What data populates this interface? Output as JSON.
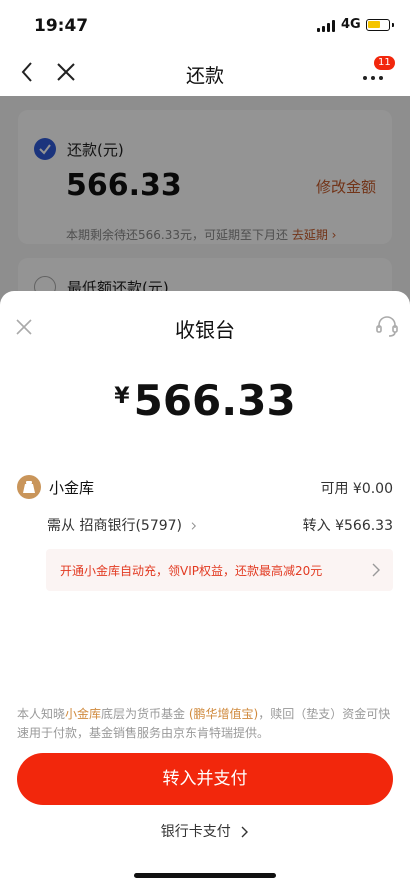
{
  "status_bar": {
    "time": "19:47",
    "network": "4G"
  },
  "nav": {
    "title": "还款",
    "badge_count": "11"
  },
  "background": {
    "repay_label": "还款(元)",
    "repay_amount": "566.33",
    "modify_label": "修改金额",
    "note_text": "本期剩余待还566.33元，可延期至下月还",
    "extend_label": "去延期 ›",
    "min_label": "最低额还款(元)"
  },
  "sheet": {
    "title": "收银台",
    "currency": "¥",
    "amount": "566.33",
    "vault": {
      "label": "小金库",
      "available": "可用 ¥0.00"
    },
    "source": {
      "prefix": "需从",
      "bank": "招商银行(5797)"
    },
    "transfer": "转入 ¥566.33",
    "promo": "开通小金库自动充，领VIP权益，还款最高减20元",
    "disclaimer": {
      "part1": "本人知晓",
      "hl1": "小金库",
      "part2": "底层为货币基金 ",
      "hl2": "(鹏华增值宝)",
      "part3": "，赎回（垫支）资金可快速用于付款，基金销售服务由京东肯特瑞提供。"
    },
    "pay_button": "转入并支付",
    "card_pay": "银行卡支付"
  },
  "colors": {
    "accent_red": "#f2270c",
    "link_orange": "#c55a2a",
    "check_blue": "#2f5bd8"
  }
}
